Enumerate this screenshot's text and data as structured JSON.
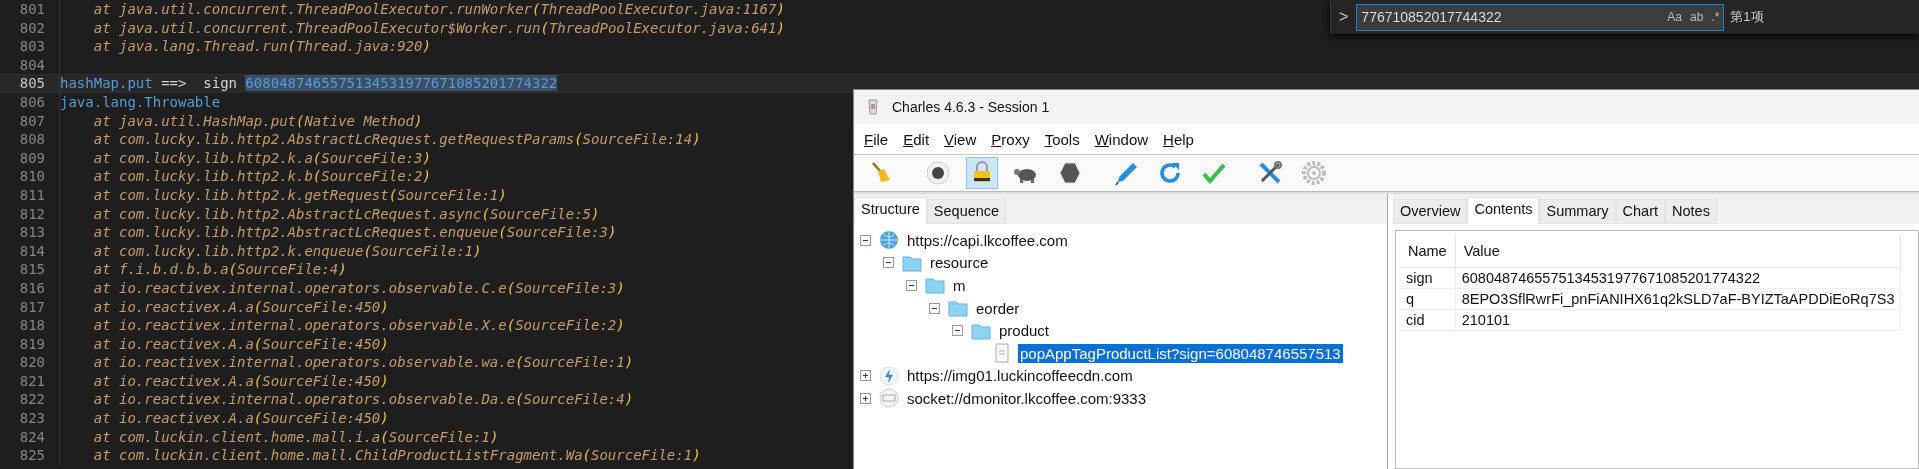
{
  "editor": {
    "lines": [
      {
        "number": "801",
        "current": false,
        "segments": [
          {
            "text": "at java.util.concurrent.ThreadPoolExecutor.runWorker",
            "kind": "frame"
          },
          {
            "text": "(",
            "kind": "paren"
          },
          {
            "text": "ThreadPoolExecutor.java:1167",
            "kind": "frame"
          },
          {
            "text": ")",
            "kind": "paren"
          }
        ]
      },
      {
        "number": "802",
        "current": false,
        "segments": [
          {
            "text": "at java.util.concurrent.ThreadPoolExecutor$Worker.run",
            "kind": "frame"
          },
          {
            "text": "(",
            "kind": "paren"
          },
          {
            "text": "ThreadPoolExecutor.java:641",
            "kind": "frame"
          },
          {
            "text": ")",
            "kind": "paren"
          }
        ]
      },
      {
        "number": "803",
        "current": false,
        "segments": [
          {
            "text": "at java.lang.Thread.run",
            "kind": "frame"
          },
          {
            "text": "(",
            "kind": "paren"
          },
          {
            "text": "Thread.java:920",
            "kind": "frame"
          },
          {
            "text": ")",
            "kind": "paren"
          }
        ]
      },
      {
        "number": "804",
        "current": false
      },
      {
        "number": "805",
        "current": true,
        "segments": [
          {
            "text": "hashMap.put",
            "kind": "keyword"
          },
          {
            "text": " ==>  sign ",
            "kind": "plain"
          },
          {
            "text": "6080487465575134531977671085201774322",
            "kind": "match"
          }
        ]
      },
      {
        "number": "806",
        "current": false,
        "segments": [
          {
            "text": "java.lang.Throwable",
            "kind": "keyword"
          }
        ]
      },
      {
        "number": "807",
        "current": false,
        "segments": [
          {
            "text": "at java.util.HashMap.put",
            "kind": "frame"
          },
          {
            "text": "(",
            "kind": "paren"
          },
          {
            "text": "Native Method",
            "kind": "frame"
          },
          {
            "text": ")",
            "kind": "paren"
          }
        ]
      },
      {
        "number": "808",
        "current": false,
        "segments": [
          {
            "text": "at com.lucky.lib.http2.AbstractLcRequest.getRequestParams",
            "kind": "frame"
          },
          {
            "text": "(",
            "kind": "paren"
          },
          {
            "text": "SourceFile:14",
            "kind": "frame"
          },
          {
            "text": ")",
            "kind": "paren"
          }
        ]
      },
      {
        "number": "809",
        "current": false,
        "segments": [
          {
            "text": "at com.lucky.lib.http2.k.a",
            "kind": "frame"
          },
          {
            "text": "(",
            "kind": "paren"
          },
          {
            "text": "SourceFile:3",
            "kind": "frame"
          },
          {
            "text": ")",
            "kind": "paren"
          }
        ]
      },
      {
        "number": "810",
        "current": false,
        "segments": [
          {
            "text": "at com.lucky.lib.http2.k.b",
            "kind": "frame"
          },
          {
            "text": "(",
            "kind": "paren"
          },
          {
            "text": "SourceFile:2",
            "kind": "frame"
          },
          {
            "text": ")",
            "kind": "paren"
          }
        ]
      },
      {
        "number": "811",
        "current": false,
        "segments": [
          {
            "text": "at com.lucky.lib.http2.k.getRequest",
            "kind": "frame"
          },
          {
            "text": "(",
            "kind": "paren"
          },
          {
            "text": "SourceFile:1",
            "kind": "frame"
          },
          {
            "text": ")",
            "kind": "paren"
          }
        ]
      },
      {
        "number": "812",
        "current": false,
        "segments": [
          {
            "text": "at com.lucky.lib.http2.AbstractLcRequest.async",
            "kind": "frame"
          },
          {
            "text": "(",
            "kind": "paren"
          },
          {
            "text": "SourceFile:5",
            "kind": "frame"
          },
          {
            "text": ")",
            "kind": "paren"
          }
        ]
      },
      {
        "number": "813",
        "current": false,
        "segments": [
          {
            "text": "at com.lucky.lib.http2.AbstractLcRequest.enqueue",
            "kind": "frame"
          },
          {
            "text": "(",
            "kind": "paren"
          },
          {
            "text": "SourceFile:3",
            "kind": "frame"
          },
          {
            "text": ")",
            "kind": "paren"
          }
        ]
      },
      {
        "number": "814",
        "current": false,
        "segments": [
          {
            "text": "at com.lucky.lib.http2.k.enqueue",
            "kind": "frame"
          },
          {
            "text": "(",
            "kind": "paren"
          },
          {
            "text": "SourceFile:1",
            "kind": "frame"
          },
          {
            "text": ")",
            "kind": "paren"
          }
        ]
      },
      {
        "number": "815",
        "current": false,
        "segments": [
          {
            "text": "at f.i.b.d.b.b.a",
            "kind": "frame"
          },
          {
            "text": "(",
            "kind": "paren"
          },
          {
            "text": "SourceFile:4",
            "kind": "frame"
          },
          {
            "text": ")",
            "kind": "paren"
          }
        ]
      },
      {
        "number": "816",
        "current": false,
        "segments": [
          {
            "text": "at io.reactivex.internal.operators.observable.C.e",
            "kind": "frame"
          },
          {
            "text": "(",
            "kind": "paren"
          },
          {
            "text": "SourceFile:3",
            "kind": "frame"
          },
          {
            "text": ")",
            "kind": "paren"
          }
        ]
      },
      {
        "number": "817",
        "current": false,
        "segments": [
          {
            "text": "at io.reactivex.A.a",
            "kind": "frame"
          },
          {
            "text": "(",
            "kind": "paren"
          },
          {
            "text": "SourceFile:450",
            "kind": "frame"
          },
          {
            "text": ")",
            "kind": "paren"
          }
        ]
      },
      {
        "number": "818",
        "current": false,
        "segments": [
          {
            "text": "at io.reactivex.internal.operators.observable.X.e",
            "kind": "frame"
          },
          {
            "text": "(",
            "kind": "paren"
          },
          {
            "text": "SourceFile:2",
            "kind": "frame"
          },
          {
            "text": ")",
            "kind": "paren"
          }
        ]
      },
      {
        "number": "819",
        "current": false,
        "segments": [
          {
            "text": "at io.reactivex.A.a",
            "kind": "frame"
          },
          {
            "text": "(",
            "kind": "paren"
          },
          {
            "text": "SourceFile:450",
            "kind": "frame"
          },
          {
            "text": ")",
            "kind": "paren"
          }
        ]
      },
      {
        "number": "820",
        "current": false,
        "segments": [
          {
            "text": "at io.reactivex.internal.operators.observable.wa.e",
            "kind": "frame"
          },
          {
            "text": "(",
            "kind": "paren"
          },
          {
            "text": "SourceFile:1",
            "kind": "frame"
          },
          {
            "text": ")",
            "kind": "paren"
          }
        ]
      },
      {
        "number": "821",
        "current": false,
        "segments": [
          {
            "text": "at io.reactivex.A.a",
            "kind": "frame"
          },
          {
            "text": "(",
            "kind": "paren"
          },
          {
            "text": "SourceFile:450",
            "kind": "frame"
          },
          {
            "text": ")",
            "kind": "paren"
          }
        ]
      },
      {
        "number": "822",
        "current": false,
        "segments": [
          {
            "text": "at io.reactivex.internal.operators.observable.Da.e",
            "kind": "frame"
          },
          {
            "text": "(",
            "kind": "paren"
          },
          {
            "text": "SourceFile:4",
            "kind": "frame"
          },
          {
            "text": ")",
            "kind": "paren"
          }
        ]
      },
      {
        "number": "823",
        "current": false,
        "segments": [
          {
            "text": "at io.reactivex.A.a",
            "kind": "frame"
          },
          {
            "text": "(",
            "kind": "paren"
          },
          {
            "text": "SourceFile:450",
            "kind": "frame"
          },
          {
            "text": ")",
            "kind": "paren"
          }
        ]
      },
      {
        "number": "824",
        "current": false,
        "segments": [
          {
            "text": "at com.luckin.client.home.mall.i.a",
            "kind": "frame"
          },
          {
            "text": "(",
            "kind": "paren"
          },
          {
            "text": "SourceFile:1",
            "kind": "frame"
          },
          {
            "text": ")",
            "kind": "paren"
          }
        ]
      },
      {
        "number": "825",
        "current": false,
        "segments": [
          {
            "text": "at com.luckin.client.home.mall.ChildProductListFragment.Wa",
            "kind": "frame"
          },
          {
            "text": "(",
            "kind": "paren"
          },
          {
            "text": "SourceFile:1",
            "kind": "frame"
          },
          {
            "text": ")",
            "kind": "paren"
          }
        ]
      }
    ]
  },
  "find_widget": {
    "toggle": ">",
    "value": "776710852017744322",
    "options": [
      {
        "label": "Aa",
        "on": false
      },
      {
        "label": "ab",
        "on": false
      },
      {
        "label": ".*",
        "on": false
      }
    ],
    "result": "第1项"
  },
  "charles": {
    "window": {
      "title": "Charles 4.6.3 - Session 1"
    },
    "menu": [
      "File",
      "Edit",
      "View",
      "Proxy",
      "Tools",
      "Window",
      "Help"
    ],
    "toolbar": [
      {
        "kind": "broom",
        "pressed": false
      },
      {
        "kind": "record",
        "pressed": false
      },
      {
        "kind": "lock",
        "pressed": true
      },
      {
        "kind": "turtle",
        "pressed": false
      },
      {
        "kind": "stop",
        "pressed": false
      },
      {
        "kind": "pen",
        "pressed": false
      },
      {
        "kind": "refresh",
        "pressed": false
      },
      {
        "kind": "check",
        "pressed": false
      },
      {
        "kind": "tools",
        "pressed": false
      },
      {
        "kind": "gear",
        "pressed": false
      }
    ],
    "left_tabs": [
      {
        "label": "Structure",
        "selected": true
      },
      {
        "label": "Sequence",
        "selected": false
      }
    ],
    "tree": [
      {
        "label": "https://capi.lkcoffee.com",
        "kind": "host",
        "expanded": true,
        "selected": false,
        "children": [
          {
            "label": "resource",
            "kind": "folder",
            "expanded": true,
            "selected": false,
            "children": [
              {
                "label": "m",
                "kind": "folder",
                "expanded": true,
                "selected": false,
                "children": [
                  {
                    "label": "eorder",
                    "kind": "folder",
                    "expanded": true,
                    "selected": false,
                    "children": [
                      {
                        "label": "product",
                        "kind": "folder",
                        "expanded": true,
                        "selected": false,
                        "children": [
                          {
                            "label": "popAppTagProductList?sign=608048746557513",
                            "kind": "file",
                            "selected": true
                          }
                        ]
                      }
                    ]
                  }
                ]
              }
            ]
          }
        ]
      },
      {
        "label": "https://img01.luckincoffeecdn.com",
        "kind": "cdn",
        "expanded": false,
        "selected": false
      },
      {
        "label": "socket://dmonitor.lkcoffee.com:9333",
        "kind": "socket",
        "expanded": false,
        "selected": false
      }
    ],
    "right_tabs": [
      {
        "label": "Overview",
        "selected": false
      },
      {
        "label": "Contents",
        "selected": true
      },
      {
        "label": "Summary",
        "selected": false
      },
      {
        "label": "Chart",
        "selected": false
      },
      {
        "label": "Notes",
        "selected": false
      }
    ],
    "table": {
      "columns": [
        "Name",
        "Value"
      ],
      "rows": [
        [
          "sign",
          "6080487465575134531977671085201774322"
        ],
        [
          "q",
          "8EPO3SflRwrFi_pnFiANIHX61q2kSLD7aF-BYIZTaAPDDiEoRq7S3"
        ],
        [
          "cid",
          "210101"
        ]
      ]
    }
  }
}
